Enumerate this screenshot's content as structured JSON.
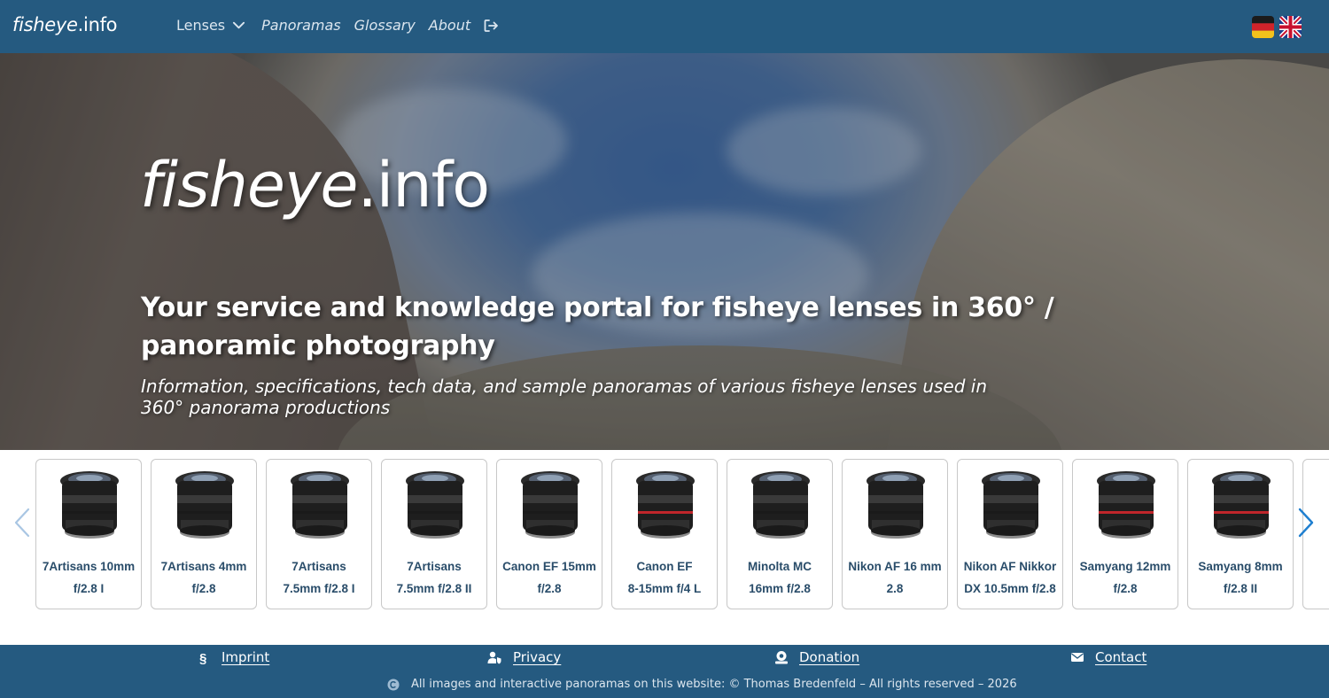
{
  "navbar": {
    "brand_italic": "fisheye",
    "brand_rest": ".info",
    "links": [
      {
        "label": "Lenses",
        "italic": false
      },
      {
        "label": "Panoramas",
        "italic": true
      },
      {
        "label": "Glossary",
        "italic": true
      },
      {
        "label": "About",
        "italic": true
      }
    ],
    "icons": [
      "chevron-down-icon",
      "logout-icon",
      "flag-de-icon",
      "flag-uk-icon"
    ]
  },
  "hero": {
    "title_italic": "fisheye",
    "title_rest": ".info",
    "subtitle": "Your service and knowledge portal for fisheye lenses in 360° / panoramic photography",
    "description": "Information, specifications, tech data, and sample panoramas of various fisheye lenses used in 360° panorama productions"
  },
  "carousel": {
    "cards": [
      {
        "line1": "7Artisans 10mm",
        "line2": "f/2.8 I",
        "accent": "#1a1a1a"
      },
      {
        "line1": "7Artisans 4mm",
        "line2": "f/2.8",
        "accent": "#1a1a1a"
      },
      {
        "line1": "7Artisans",
        "line2": "7.5mm f/2.8 I",
        "accent": "#1a1a1a"
      },
      {
        "line1": "7Artisans",
        "line2": "7.5mm f/2.8 II",
        "accent": "#1a1a1a"
      },
      {
        "line1": "Canon EF 15mm",
        "line2": "f/2.8",
        "accent": "#1a1a1a"
      },
      {
        "line1": "Canon EF",
        "line2": "8-15mm f/4 L",
        "accent": "#c0262b"
      },
      {
        "line1": "Minolta MC",
        "line2": "16mm f/2.8",
        "accent": "#1a1a1a"
      },
      {
        "line1": "Nikon AF 16 mm",
        "line2": "2.8",
        "accent": "#1a1a1a"
      },
      {
        "line1": "Nikon AF Nikkor",
        "line2": "DX 10.5mm f/2.8",
        "accent": "#1a1a1a"
      },
      {
        "line1": "Samyang 12mm",
        "line2": "f/2.8",
        "accent": "#c0262b"
      },
      {
        "line1": "Samyang 8mm",
        "line2": "f/2.8 II",
        "accent": "#c0262b"
      }
    ]
  },
  "footer": {
    "links": [
      {
        "label": "Imprint",
        "icon": "paragraph-icon"
      },
      {
        "label": "Privacy",
        "icon": "user-shield-icon"
      },
      {
        "label": "Donation",
        "icon": "donation-icon"
      },
      {
        "label": "Contact",
        "icon": "envelope-icon"
      }
    ],
    "copyright": "All images and interactive panoramas on this website: © Thomas Bredenfeld – All rights reserved – 2026"
  },
  "colors": {
    "nav_bg": "#255a80",
    "accent_text": "#2a4d6a",
    "arrow": "#1f7fd0"
  }
}
